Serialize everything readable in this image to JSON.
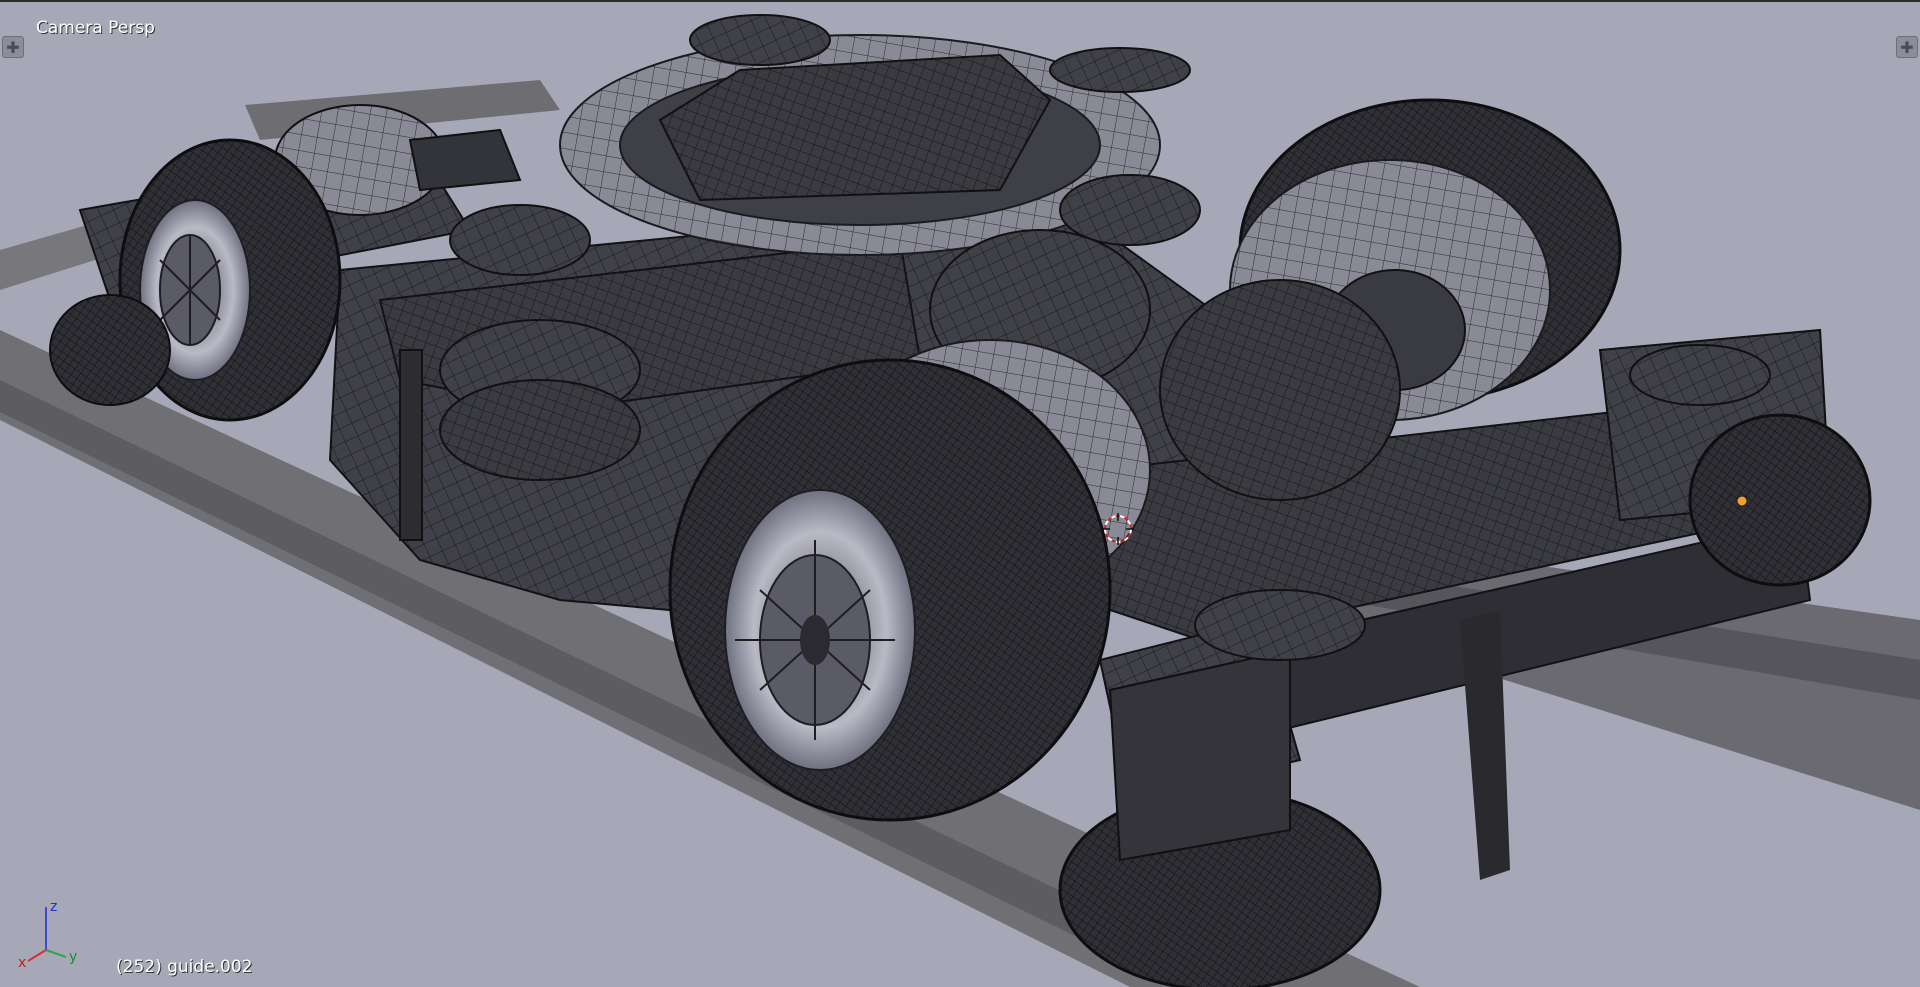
{
  "viewport": {
    "view_name": "Camera Persp",
    "object_info": "(252) guide.002",
    "background_color": "#a7a8b7",
    "mesh_color": "#3b3b42",
    "wire_color": "#151518",
    "selected_color": "#f0a030"
  },
  "axes": {
    "x": "x",
    "y": "y",
    "z": "z"
  },
  "icons": {
    "split_left": "plus-icon",
    "split_right": "plus-icon",
    "cursor": "3d-cursor-icon"
  }
}
